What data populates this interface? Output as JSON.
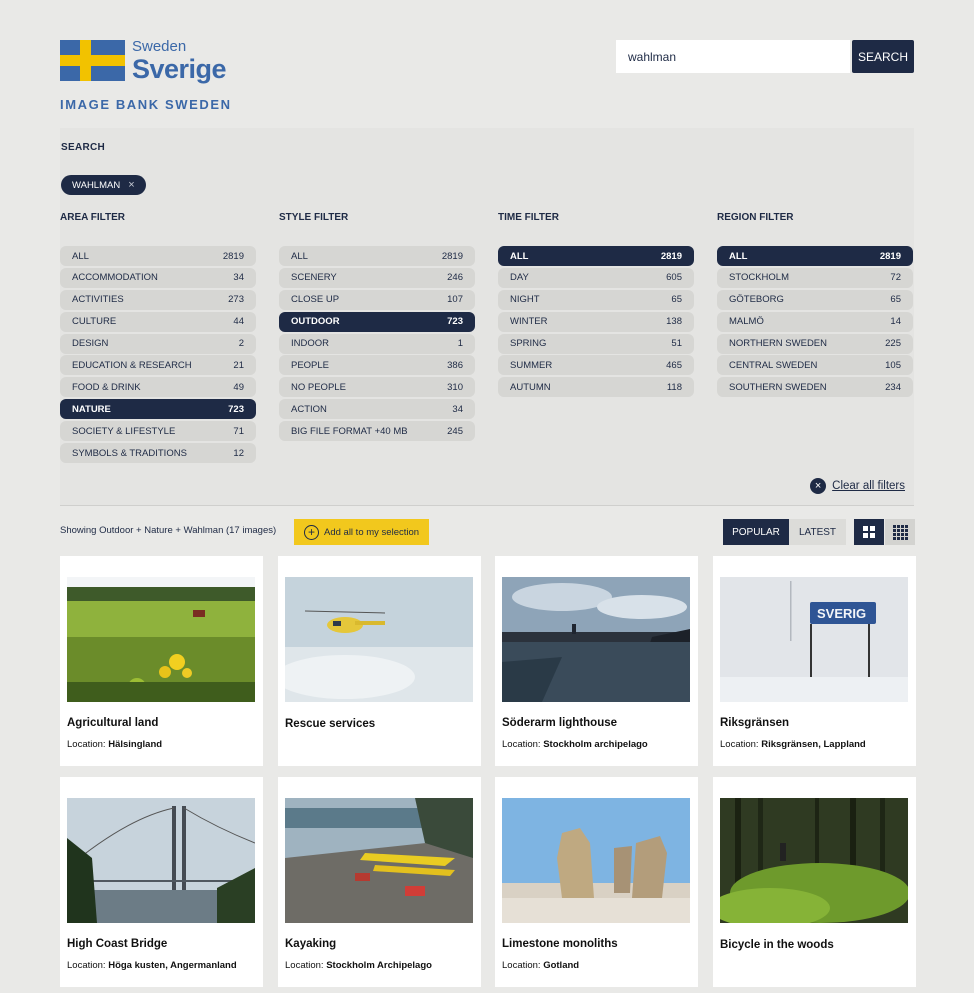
{
  "logo": {
    "small": "Sweden",
    "big": "Sverige",
    "tagline": "IMAGE BANK SWEDEN"
  },
  "search": {
    "value": "wahlman",
    "button": "SEARCH"
  },
  "panel": {
    "search_label": "SEARCH",
    "tag": "WAHLMAN",
    "tag_close": "×",
    "filters": [
      {
        "title": "AREA FILTER",
        "items": [
          {
            "label": "ALL",
            "count": "2819"
          },
          {
            "label": "ACCOMMODATION",
            "count": "34"
          },
          {
            "label": "ACTIVITIES",
            "count": "273"
          },
          {
            "label": "CULTURE",
            "count": "44"
          },
          {
            "label": "DESIGN",
            "count": "2"
          },
          {
            "label": "EDUCATION & RESEARCH",
            "count": "21"
          },
          {
            "label": "FOOD & DRINK",
            "count": "49"
          },
          {
            "label": "NATURE",
            "count": "723",
            "active": true
          },
          {
            "label": "SOCIETY & LIFESTYLE",
            "count": "71"
          },
          {
            "label": "SYMBOLS & TRADITIONS",
            "count": "12"
          }
        ]
      },
      {
        "title": "STYLE FILTER",
        "items": [
          {
            "label": "ALL",
            "count": "2819"
          },
          {
            "label": "SCENERY",
            "count": "246"
          },
          {
            "label": "CLOSE UP",
            "count": "107"
          },
          {
            "label": "OUTDOOR",
            "count": "723",
            "active": true
          },
          {
            "label": "INDOOR",
            "count": "1"
          },
          {
            "label": "PEOPLE",
            "count": "386"
          },
          {
            "label": "NO PEOPLE",
            "count": "310"
          },
          {
            "label": "ACTION",
            "count": "34"
          },
          {
            "label": "BIG FILE FORMAT +40 MB",
            "count": "245"
          }
        ]
      },
      {
        "title": "TIME FILTER",
        "items": [
          {
            "label": "ALL",
            "count": "2819",
            "active": true
          },
          {
            "label": "DAY",
            "count": "605"
          },
          {
            "label": "NIGHT",
            "count": "65"
          },
          {
            "label": "WINTER",
            "count": "138"
          },
          {
            "label": "SPRING",
            "count": "51"
          },
          {
            "label": "SUMMER",
            "count": "465"
          },
          {
            "label": "AUTUMN",
            "count": "118"
          }
        ]
      },
      {
        "title": "REGION FILTER",
        "items": [
          {
            "label": "ALL",
            "count": "2819",
            "active": true
          },
          {
            "label": "STOCKHOLM",
            "count": "72"
          },
          {
            "label": "GÖTEBORG",
            "count": "65"
          },
          {
            "label": "MALMÖ",
            "count": "14"
          },
          {
            "label": "NORTHERN SWEDEN",
            "count": "225"
          },
          {
            "label": "CENTRAL SWEDEN",
            "count": "105"
          },
          {
            "label": "SOUTHERN SWEDEN",
            "count": "234"
          }
        ]
      }
    ],
    "clear_icon": "×",
    "clear_label": "Clear all filters"
  },
  "results": {
    "showing": "Showing Outdoor + Nature + Wahlman (17 images)",
    "add_all_icon": "+",
    "add_all": "Add all to my selection",
    "sort_popular": "POPULAR",
    "sort_latest": "LATEST"
  },
  "location_prefix": "Location:",
  "cards": [
    {
      "title": "Agricultural land",
      "location": "Hälsingland"
    },
    {
      "title": "Rescue services",
      "location": ""
    },
    {
      "title": "Söderarm lighthouse",
      "location": "Stockholm archipelago"
    },
    {
      "title": "Riksgränsen",
      "location": "Riksgränsen, Lappland",
      "sign_text": "SVERIG"
    },
    {
      "title": "High Coast Bridge",
      "location": "Höga kusten, Angermanland"
    },
    {
      "title": "Kayaking",
      "location": "Stockholm Archipelago"
    },
    {
      "title": "Limestone monoliths",
      "location": "Gotland"
    },
    {
      "title": "Bicycle in the woods",
      "location": ""
    }
  ],
  "colors": {
    "navy": "#1e2a45",
    "brand_blue": "#3b68a8",
    "flag_yellow": "#f2c200",
    "add_yellow": "#f2c81d",
    "background": "#e9e9e7"
  }
}
